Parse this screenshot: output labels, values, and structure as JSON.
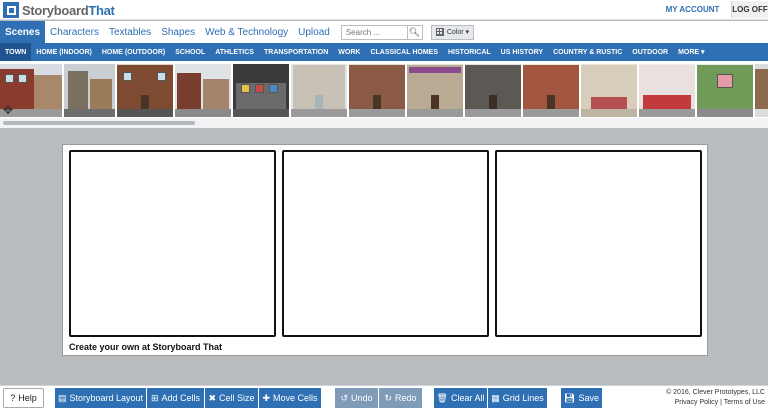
{
  "header": {
    "logo_prefix": "Storyboard",
    "logo_suffix": "That",
    "my_account": "MY ACCOUNT",
    "log_off": "LOG OFF"
  },
  "tabs": [
    {
      "label": "Scenes",
      "active": true
    },
    {
      "label": "Characters",
      "active": false
    },
    {
      "label": "Textables",
      "active": false
    },
    {
      "label": "Shapes",
      "active": false
    },
    {
      "label": "Web & Technology",
      "active": false
    },
    {
      "label": "Upload",
      "active": false
    }
  ],
  "search": {
    "placeholder": "Search ...",
    "icon": "search-icon"
  },
  "color_button": {
    "label": "Color",
    "icon": "grid-icon"
  },
  "categories": [
    {
      "label": "TOWN",
      "active": true
    },
    {
      "label": "HOME (INDOOR)"
    },
    {
      "label": "HOME (OUTDOOR)"
    },
    {
      "label": "SCHOOL"
    },
    {
      "label": "ATHLETICS"
    },
    {
      "label": "TRANSPORTATION"
    },
    {
      "label": "WORK"
    },
    {
      "label": "CLASSICAL HOMES"
    },
    {
      "label": "HISTORICAL"
    },
    {
      "label": "US HISTORY"
    },
    {
      "label": "COUNTRY & RUSTIC"
    },
    {
      "label": "OUTDOOR"
    },
    {
      "label": "MORE ▾"
    }
  ],
  "canvas": {
    "credit": "Create your own at Storyboard That",
    "cell_count": 3
  },
  "toolbar": {
    "help": "Help",
    "storyboard_layout": "Storyboard Layout",
    "add_cells": "Add Cells",
    "cell_size": "Cell Size",
    "move_cells": "Move Cells",
    "undo": "Undo",
    "redo": "Redo",
    "clear_all": "Clear All",
    "grid_lines": "Grid Lines",
    "save": "Save"
  },
  "footer": {
    "copyright": "© 2016, Clever Prototypes, LLC",
    "privacy": "Privacy Policy",
    "divider": "|",
    "terms": "Terms of Use"
  },
  "colors": {
    "brand_blue": "#2f6fb3",
    "background": "#b9bcbf"
  }
}
